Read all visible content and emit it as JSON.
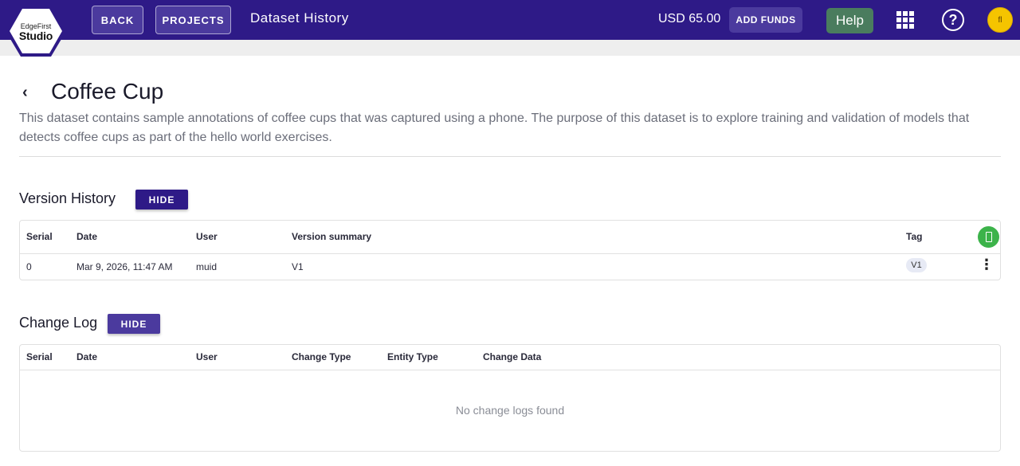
{
  "header": {
    "logo_small": "EdgeFirst",
    "logo_big": "Studio",
    "back_label": "BACK",
    "projects_label": "PROJECTS",
    "page_heading": "Dataset History",
    "balance": "USD 65.00",
    "add_funds_label": "ADD FUNDS",
    "help_label": "Help",
    "avatar_initials": "fl",
    "bar_color": "#2e1a87"
  },
  "dataset": {
    "title": "Coffee Cup",
    "description": "This dataset contains sample annotations of coffee cups that was captured using a phone. The purpose of this dataset is to explore training and validation of models that detects coffee cups as part of the hello world exercises."
  },
  "version_history": {
    "title": "Version History",
    "hide_label": "HIDE",
    "hide_color": "#2e1a87",
    "columns": [
      "Serial",
      "Date",
      "User",
      "Version summary",
      "Tag"
    ],
    "rows": [
      {
        "serial": "0",
        "date": "Mar 9, 2026, 11:47 AM",
        "user": "muid",
        "summary": "V1",
        "tag": "V1"
      }
    ]
  },
  "change_log": {
    "title": "Change Log",
    "hide_label": "HIDE",
    "hide_color": "#4b3a9e",
    "columns": [
      "Serial",
      "Date",
      "User",
      "Change Type",
      "Entity Type",
      "Change Data"
    ],
    "empty_message": "No change logs found"
  },
  "icons": {
    "back": "chevron-left-icon",
    "apps": "apps-grid-icon",
    "help": "question-circle-icon",
    "row_menu": "more-vertical-icon",
    "add_version": "add-version-icon"
  }
}
